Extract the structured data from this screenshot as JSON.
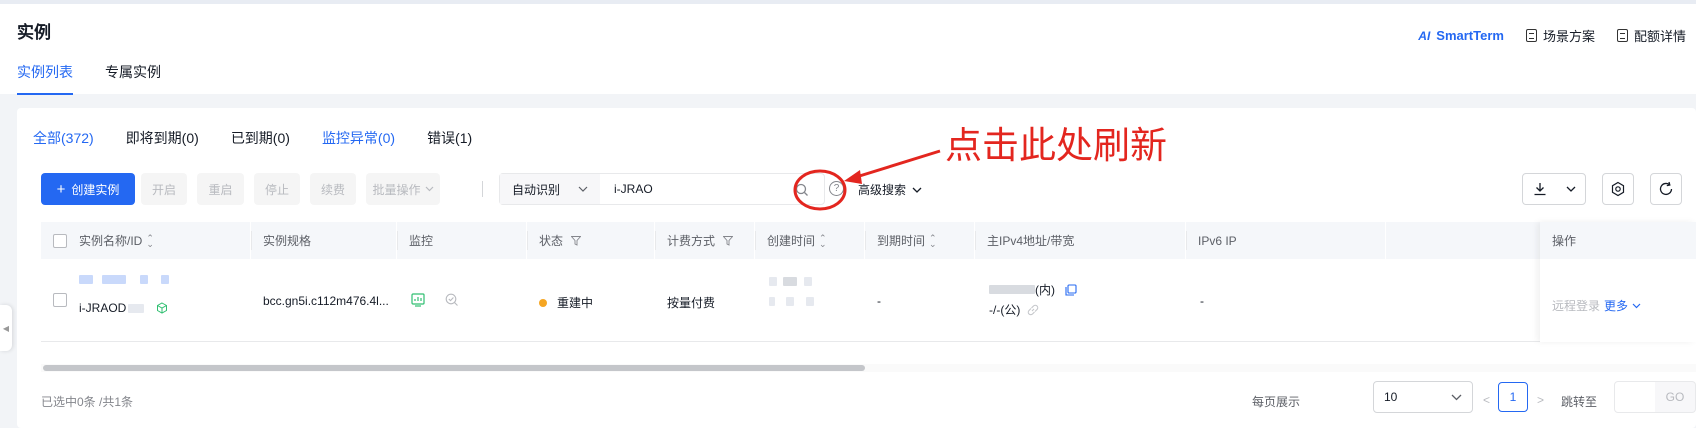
{
  "header": {
    "title": "实例",
    "actions": {
      "ai_badge": "AI",
      "smartterm": "SmartTerm",
      "scenario": "场景方案",
      "config_detail": "配额详情"
    },
    "tabs": [
      {
        "label": "实例列表",
        "active": true
      },
      {
        "label": "专属实例",
        "active": false
      }
    ]
  },
  "status_tabs": [
    {
      "label": "全部(372)",
      "active": true
    },
    {
      "label": "即将到期(0)"
    },
    {
      "label": "已到期(0)"
    },
    {
      "label": "监控异常(0)"
    },
    {
      "label": "错误(1)"
    }
  ],
  "toolbar": {
    "create_label": "创建实例",
    "start_label": "开启",
    "restart_label": "重启",
    "stop_label": "停止",
    "renew_label": "续费",
    "batch_label": "批量操作",
    "search_mode": "自动识别",
    "search_value": "i-JRAO",
    "help": "?",
    "advanced_search": "高级搜索"
  },
  "annotation": {
    "text": "点击此处刷新",
    "color": "#e3261f"
  },
  "table": {
    "headers": {
      "name": "实例名称/ID",
      "spec": "实例规格",
      "monitor": "监控",
      "status": "状态",
      "billing": "计费方式",
      "created": "创建时间",
      "expire": "到期时间",
      "ipv4": "主IPv4地址/带宽",
      "ipv6": "IPv6 IP",
      "ops": "操作"
    },
    "rows": [
      {
        "id": "i-JRAOD",
        "spec": "bcc.gn5i.c112m476.4l...",
        "status": "重建中",
        "status_color": "#f5a623",
        "billing": "按量付费",
        "expire": "-",
        "ipv4_inner_suffix": "(内)",
        "ipv4_public": "-/-(公)",
        "ipv6": "-",
        "op_remote": "远程登录",
        "op_more": "更多"
      }
    ]
  },
  "footer": {
    "selected_info": "已选中0条 /共1条",
    "per_page_label": "每页展示",
    "per_page_value": "10",
    "prev": "<",
    "current_page": "1",
    "next": ">",
    "jump_label": "跳转至",
    "go_label": "GO"
  },
  "colors": {
    "primary": "#2468f2",
    "warning": "#f5a623",
    "annotation": "#e3261f"
  }
}
